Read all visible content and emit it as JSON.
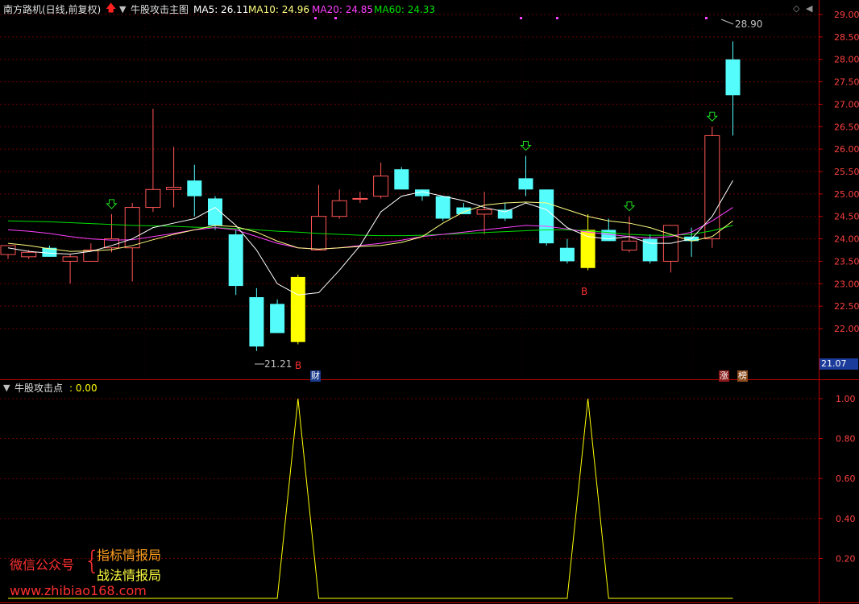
{
  "header": {
    "stock_name": "南方路机(日线,前复权)",
    "arrow_icon": "red-up-arrow-icon",
    "main_indicator": "牛股攻击主图",
    "ma5": "MA5: 26.11",
    "ma10": "MA10: 24.96",
    "ma20": "MA20: 24.85",
    "ma60": "MA60: 24.33"
  },
  "sub_header": {
    "name": "牛股攻击点",
    "value": ": 0.00"
  },
  "annotations": {
    "high_label": "28.90",
    "low_label": "21.21",
    "signal_b": "B",
    "cai": "财",
    "zhang": "涨",
    "bang": "榜",
    "price_tag": "21.07"
  },
  "watermark": {
    "label": "微信公众号",
    "line1": "指标情报局",
    "line2": "战法情报局",
    "url": "www.zhibiao168.com"
  },
  "colors": {
    "up": "#ff5555",
    "down": "#54fcfc",
    "signal": "#ffff00",
    "ma5": "#ffffff",
    "ma10": "#ffff80",
    "ma20": "#ff40ff",
    "ma60": "#00e000",
    "axis": "#c00000"
  },
  "chart_data": [
    {
      "type": "candlestick",
      "ylim": [
        21.07,
        29.0
      ],
      "yticks": [
        "29.00",
        "28.50",
        "28.00",
        "27.50",
        "27.00",
        "26.50",
        "26.00",
        "25.50",
        "25.00",
        "24.50",
        "24.00",
        "23.50",
        "23.00",
        "22.50",
        "22.00"
      ],
      "candles": [
        {
          "o": 23.65,
          "h": 23.85,
          "l": 23.55,
          "c": 23.85
        },
        {
          "o": 23.6,
          "h": 23.75,
          "l": 23.55,
          "c": 23.7
        },
        {
          "o": 23.8,
          "h": 23.85,
          "l": 23.6,
          "c": 23.6
        },
        {
          "o": 23.5,
          "h": 23.65,
          "l": 23.0,
          "c": 23.6
        },
        {
          "o": 23.5,
          "h": 23.9,
          "l": 23.5,
          "c": 23.75
        },
        {
          "o": 23.8,
          "h": 24.55,
          "l": 23.7,
          "c": 24.0
        },
        {
          "o": 23.8,
          "h": 24.8,
          "l": 23.05,
          "c": 24.7
        },
        {
          "o": 24.7,
          "h": 26.9,
          "l": 24.6,
          "c": 25.1
        },
        {
          "o": 25.1,
          "h": 26.05,
          "l": 24.7,
          "c": 25.15
        },
        {
          "o": 25.3,
          "h": 25.65,
          "l": 24.5,
          "c": 24.95
        },
        {
          "o": 24.9,
          "h": 24.95,
          "l": 24.2,
          "c": 24.3
        },
        {
          "o": 24.1,
          "h": 24.2,
          "l": 22.75,
          "c": 22.95
        },
        {
          "o": 22.7,
          "h": 22.9,
          "l": 21.5,
          "c": 21.6
        },
        {
          "o": 22.55,
          "h": 22.65,
          "l": 21.95,
          "c": 21.9
        },
        {
          "o": 21.7,
          "h": 23.2,
          "l": 21.65,
          "c": 23.15,
          "signal": true
        },
        {
          "o": 23.75,
          "h": 25.2,
          "l": 23.75,
          "c": 24.5
        },
        {
          "o": 24.5,
          "h": 25.1,
          "l": 24.45,
          "c": 24.85
        },
        {
          "o": 24.9,
          "h": 25.05,
          "l": 24.8,
          "c": 24.9
        },
        {
          "o": 24.95,
          "h": 25.7,
          "l": 24.9,
          "c": 25.4
        },
        {
          "o": 25.55,
          "h": 25.6,
          "l": 25.1,
          "c": 25.1
        },
        {
          "o": 25.1,
          "h": 25.1,
          "l": 24.85,
          "c": 24.95
        },
        {
          "o": 24.95,
          "h": 24.95,
          "l": 24.4,
          "c": 24.45
        },
        {
          "o": 24.7,
          "h": 24.8,
          "l": 24.55,
          "c": 24.55
        },
        {
          "o": 24.55,
          "h": 25.05,
          "l": 24.1,
          "c": 24.65
        },
        {
          "o": 24.65,
          "h": 24.8,
          "l": 24.4,
          "c": 24.45
        },
        {
          "o": 25.35,
          "h": 25.85,
          "l": 24.95,
          "c": 25.1
        },
        {
          "o": 25.1,
          "h": 25.1,
          "l": 23.85,
          "c": 23.9
        },
        {
          "o": 23.8,
          "h": 24.0,
          "l": 23.45,
          "c": 23.5
        },
        {
          "o": 23.35,
          "h": 24.55,
          "l": 23.3,
          "c": 24.2,
          "signal": true
        },
        {
          "o": 24.2,
          "h": 24.45,
          "l": 23.95,
          "c": 23.95
        },
        {
          "o": 23.75,
          "h": 24.5,
          "l": 23.7,
          "c": 23.95
        },
        {
          "o": 24.0,
          "h": 24.1,
          "l": 23.45,
          "c": 23.5
        },
        {
          "o": 23.5,
          "h": 24.3,
          "l": 23.25,
          "c": 24.3
        },
        {
          "o": 24.05,
          "h": 24.25,
          "l": 23.6,
          "c": 23.95
        },
        {
          "o": 24.0,
          "h": 26.5,
          "l": 23.8,
          "c": 26.3
        },
        {
          "o": 28.0,
          "h": 28.4,
          "l": 26.3,
          "c": 27.2
        }
      ],
      "buy_marks": [
        5,
        25,
        30,
        34
      ],
      "b_marks": [
        14,
        28
      ],
      "ma5": [
        23.8,
        23.72,
        23.68,
        23.66,
        23.72,
        23.85,
        24.0,
        24.25,
        24.35,
        24.45,
        24.7,
        24.3,
        23.75,
        23.0,
        22.75,
        22.8,
        23.3,
        23.85,
        24.6,
        24.95,
        25.05,
        24.95,
        24.85,
        24.7,
        24.6,
        24.8,
        24.65,
        24.25,
        24.05,
        24.0,
        24.05,
        23.9,
        23.9,
        24.0,
        24.5,
        25.3
      ],
      "ma10": [
        23.9,
        23.85,
        23.78,
        23.72,
        23.73,
        23.76,
        23.85,
        23.98,
        24.1,
        24.2,
        24.3,
        24.27,
        24.15,
        23.95,
        23.8,
        23.77,
        23.8,
        23.83,
        23.85,
        23.92,
        24.05,
        24.35,
        24.6,
        24.75,
        24.8,
        24.82,
        24.8,
        24.65,
        24.5,
        24.4,
        24.35,
        24.25,
        24.1,
        23.95,
        24.05,
        24.4
      ],
      "ma20": [
        24.2,
        24.17,
        24.12,
        24.05,
        24.0,
        23.97,
        23.98,
        24.05,
        24.12,
        24.2,
        24.25,
        24.2,
        24.05,
        23.9,
        23.8,
        23.77,
        23.8,
        23.85,
        23.9,
        23.97,
        24.05,
        24.1,
        24.15,
        24.2,
        24.25,
        24.3,
        24.28,
        24.22,
        24.15,
        24.1,
        24.05,
        24.02,
        24.05,
        24.15,
        24.4,
        24.7
      ],
      "ma60": [
        24.4,
        24.39,
        24.38,
        24.36,
        24.34,
        24.32,
        24.3,
        24.29,
        24.28,
        24.26,
        24.25,
        24.23,
        24.2,
        24.17,
        24.15,
        24.12,
        24.1,
        24.08,
        24.07,
        24.07,
        24.08,
        24.1,
        24.12,
        24.14,
        24.16,
        24.18,
        24.2,
        24.2,
        24.18,
        24.14,
        24.1,
        24.08,
        24.08,
        24.1,
        24.18,
        24.3
      ]
    },
    {
      "type": "line",
      "name": "牛股攻击点",
      "ylim": [
        0,
        1.0
      ],
      "yticks": [
        "1.00",
        "0.80",
        "0.60",
        "0.40",
        "0.20"
      ],
      "values": [
        0,
        0,
        0,
        0,
        0,
        0,
        0,
        0,
        0,
        0,
        0,
        0,
        0,
        0,
        1,
        0,
        0,
        0,
        0,
        0,
        0,
        0,
        0,
        0,
        0,
        0,
        0,
        0,
        1,
        0,
        0,
        0,
        0,
        0,
        0,
        0
      ]
    }
  ]
}
